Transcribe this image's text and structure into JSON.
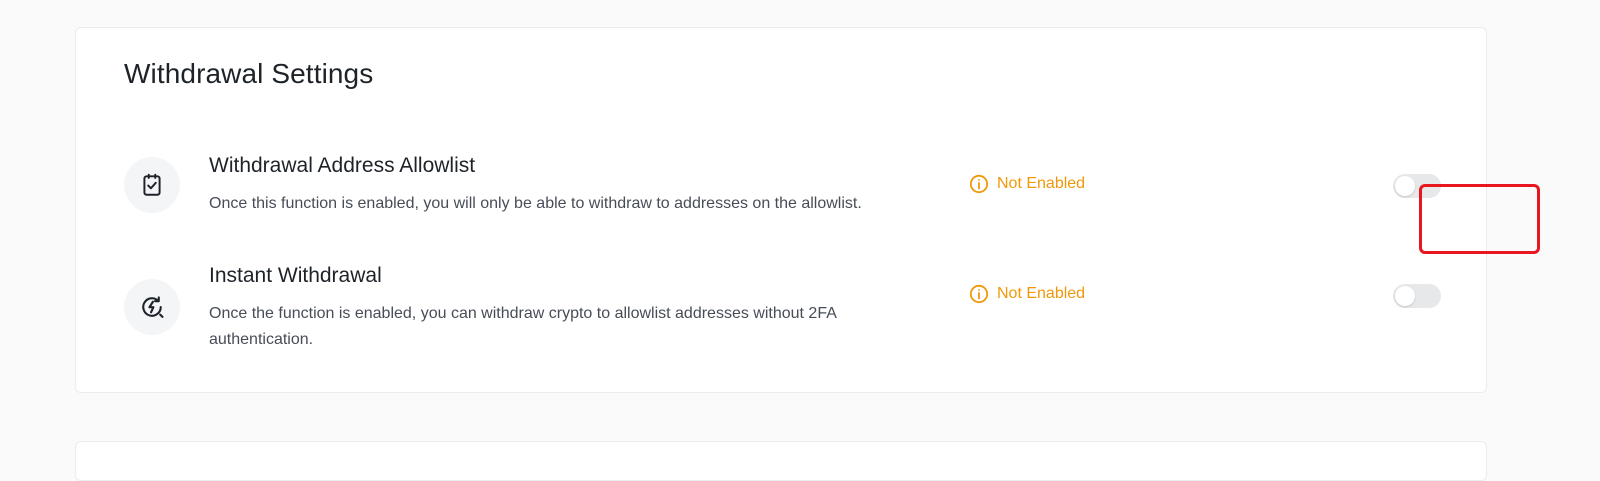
{
  "settings_card": {
    "title": "Withdrawal Settings",
    "items": [
      {
        "icon": "clipboard-check-icon",
        "title": "Withdrawal Address Allowlist",
        "description": "Once this function is enabled, you will only be able to withdraw to addresses on the allowlist.",
        "status": "Not Enabled",
        "toggle_on": false
      },
      {
        "icon": "instant-lightning-icon",
        "title": "Instant Withdrawal",
        "description": "Once the function is enabled, you can withdraw crypto to allowlist addresses without 2FA authentication.",
        "status": "Not Enabled",
        "toggle_on": false
      }
    ]
  },
  "colors": {
    "status_warning": "#f0980a",
    "toggle_off": "#e6e8ea",
    "highlight": "#e8161e",
    "text_primary": "#1e2329",
    "text_secondary": "#474d57"
  }
}
